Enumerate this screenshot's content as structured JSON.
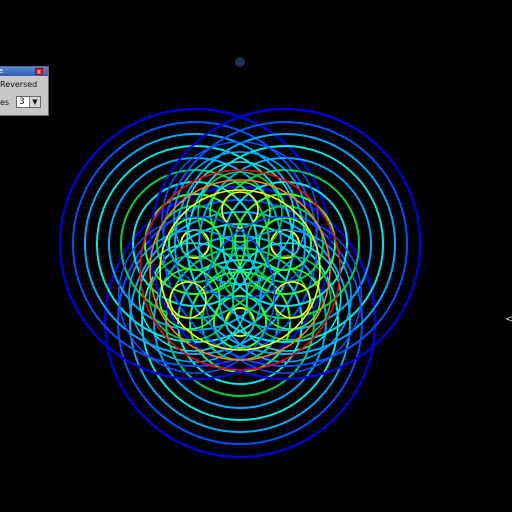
{
  "panel": {
    "title_fragment": "e",
    "close_label": "x",
    "reversed_label": "Reversed",
    "count_label_fragment": "es",
    "count_value": "3",
    "dropdown_arrow": "▼"
  },
  "edge_handle_glyph": "<",
  "art": {
    "symmetry_order": 3,
    "ring_count": 7,
    "palette": [
      "#0000d8",
      "#0050ff",
      "#00a8ff",
      "#00e8e8",
      "#00d050",
      "#30ff30",
      "#ffff00",
      "#ff8000",
      "#ff0000"
    ],
    "background": "#000000"
  }
}
